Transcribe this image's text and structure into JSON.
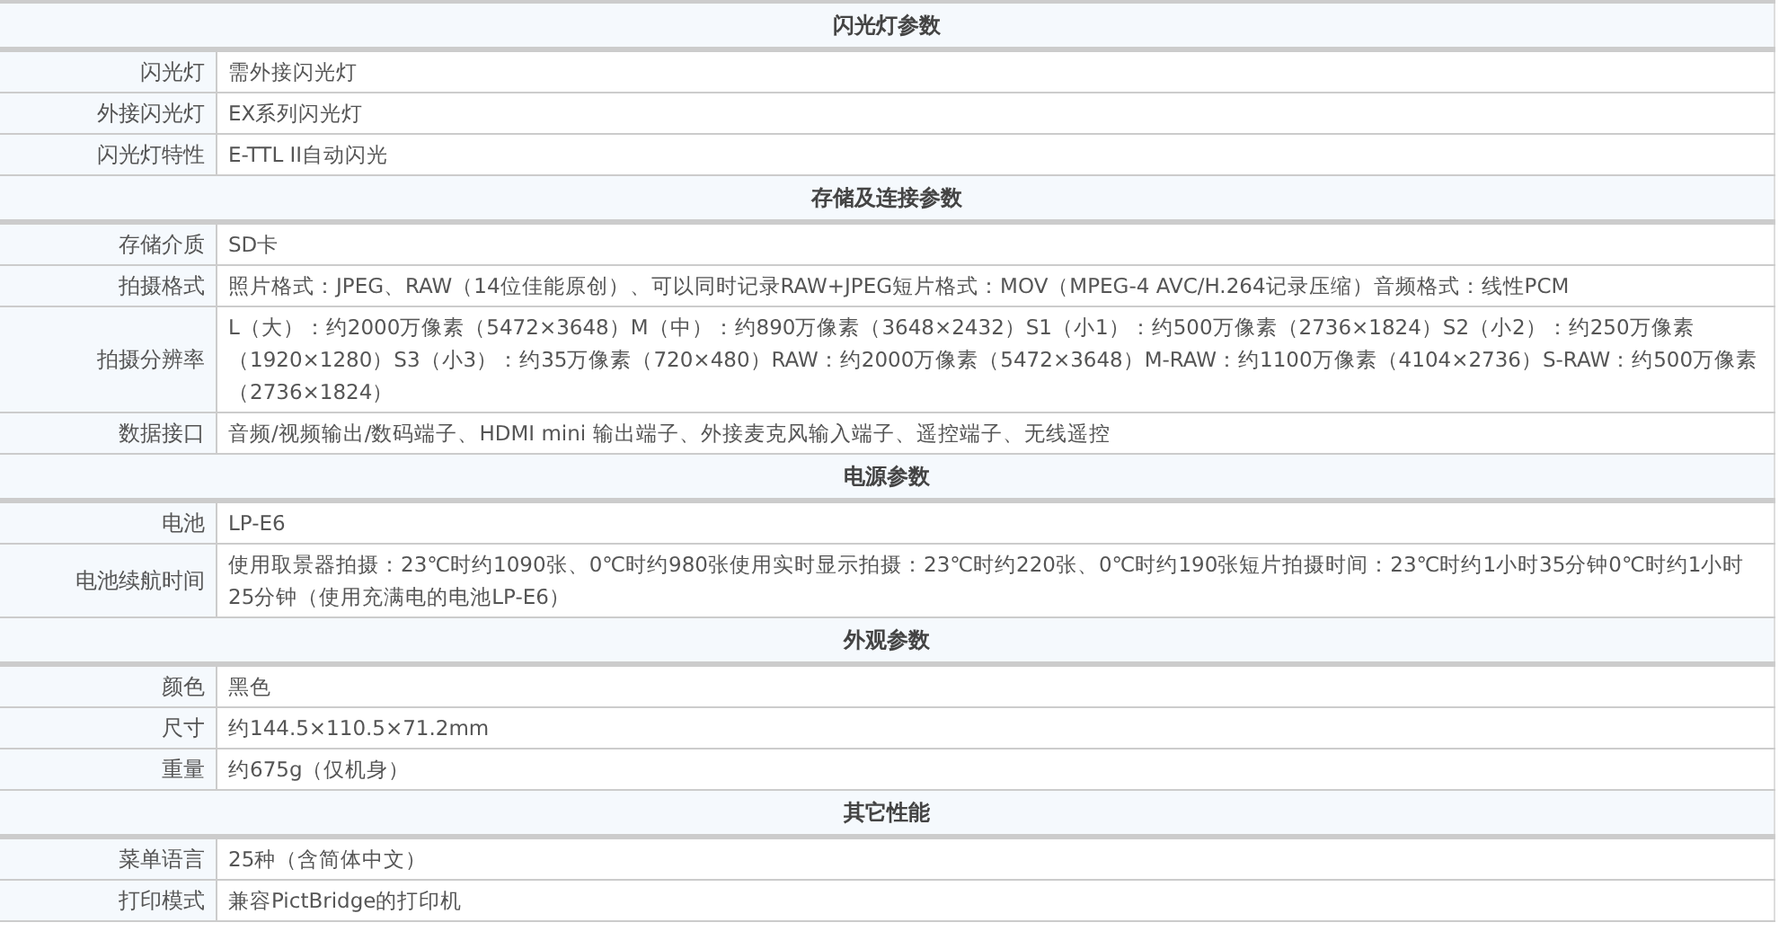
{
  "sections": [
    {
      "title": "闪光灯参数",
      "rows": [
        {
          "label": "闪光灯",
          "value": "需外接闪光灯"
        },
        {
          "label": "外接闪光灯",
          "value": "EX系列闪光灯"
        },
        {
          "label": "闪光灯特性",
          "value": "E-TTL II自动闪光"
        }
      ]
    },
    {
      "title": "存储及连接参数",
      "rows": [
        {
          "label": "存储介质",
          "value": "SD卡"
        },
        {
          "label": "拍摄格式",
          "value": "照片格式：JPEG、RAW（14位佳能原创）、可以同时记录RAW+JPEG短片格式：MOV（MPEG-4 AVC/H.264记录压缩）音频格式：线性PCM"
        },
        {
          "label": "拍摄分辨率",
          "value": "L（大）：约2000万像素（5472×3648）M（中）：约890万像素（3648×2432）S1（小1）：约500万像素（2736×1824）S2（小2）：约250万像素（1920×1280）S3（小3）：约35万像素（720×480）RAW：约2000万像素（5472×3648）M-RAW：约1100万像素（4104×2736）S-RAW：约500万像素（2736×1824）"
        },
        {
          "label": "数据接口",
          "value": "音频/视频输出/数码端子、HDMI mini 输出端子、外接麦克风输入端子、遥控端子、无线遥控"
        }
      ]
    },
    {
      "title": "电源参数",
      "rows": [
        {
          "label": "电池",
          "value": "LP-E6"
        },
        {
          "label": "电池续航时间",
          "value": "使用取景器拍摄：23℃时约1090张、0℃时约980张使用实时显示拍摄：23℃时约220张、0℃时约190张短片拍摄时间：23℃时约1小时35分钟0℃时约1小时25分钟（使用充满电的电池LP-E6）"
        }
      ]
    },
    {
      "title": "外观参数",
      "rows": [
        {
          "label": "颜色",
          "value": "黑色"
        },
        {
          "label": "尺寸",
          "value": "约144.5×110.5×71.2mm"
        },
        {
          "label": "重量",
          "value": "约675g（仅机身）"
        }
      ]
    },
    {
      "title": "其它性能",
      "rows": [
        {
          "label": "菜单语言",
          "value": "25种（含简体中文）"
        },
        {
          "label": "打印模式",
          "value": "兼容PictBridge的打印机"
        }
      ]
    }
  ]
}
